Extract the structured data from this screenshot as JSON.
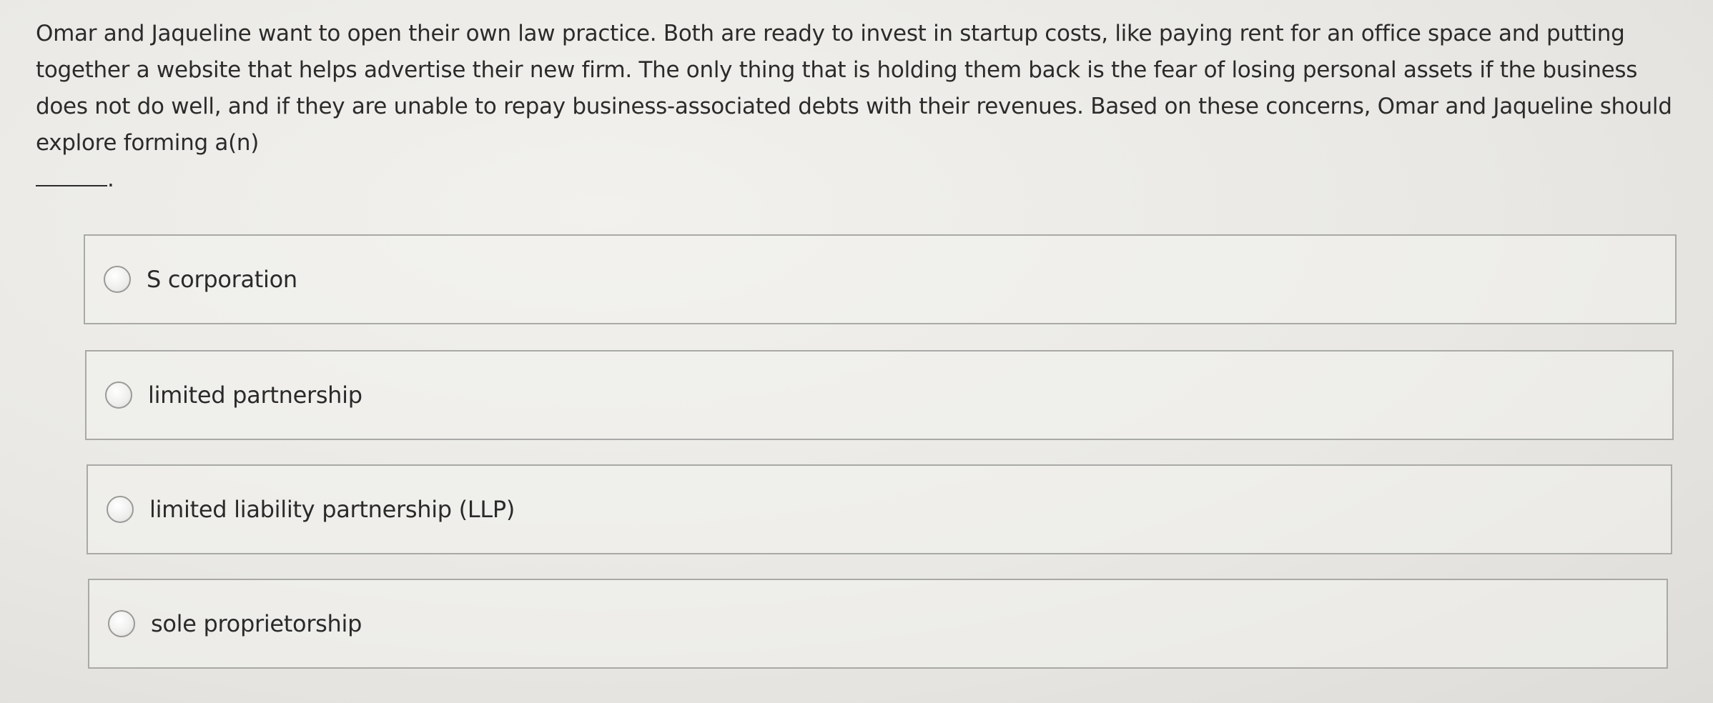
{
  "question": {
    "text": "Omar and Jaqueline want to open their own law practice. Both are ready to invest in startup costs, like paying rent for an office space and putting together a website that helps advertise their new firm. The only thing that is holding them back is the fear of losing personal assets if the business does not do well, and if they are unable to repay business-associated debts with their revenues. Based on these concerns, Omar and Jaqueline should explore forming a(n)",
    "after_blank": "."
  },
  "options": [
    {
      "label": "S corporation"
    },
    {
      "label": "limited partnership"
    },
    {
      "label": "limited liability partnership (LLP)"
    },
    {
      "label": "sole proprietorship"
    }
  ]
}
